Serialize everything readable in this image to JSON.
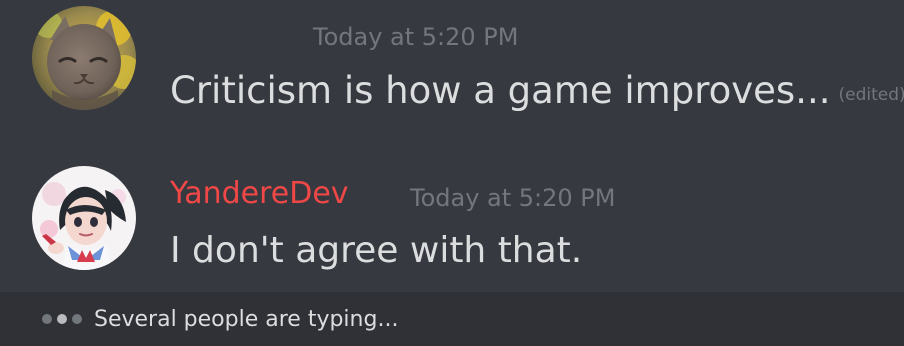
{
  "messages": [
    {
      "timestamp": "Today at 5:20 PM",
      "content": "Criticism is how a game improves...",
      "edited": "(edited)",
      "avatar_icon": "cat-avatar-icon"
    },
    {
      "author": "YandereDev",
      "timestamp": "Today at 5:20 PM",
      "content": "I don't agree with that.",
      "avatar_icon": "anime-girl-avatar-icon"
    }
  ],
  "typing": {
    "text": "Several people are typing..."
  },
  "colors": {
    "background": "#36393f",
    "typing_bar": "#2f3136",
    "text": "#dcddde",
    "muted": "#72767d",
    "author": "#f04747"
  }
}
